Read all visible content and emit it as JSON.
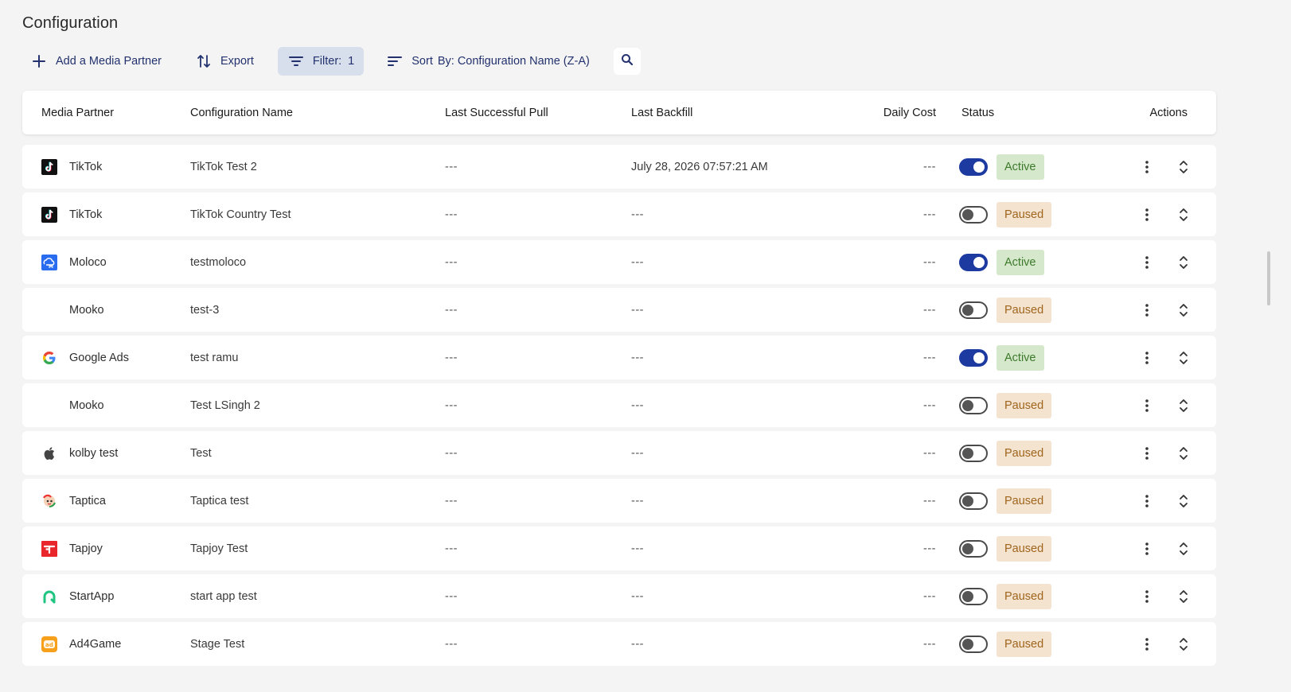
{
  "page": {
    "title": "Configuration"
  },
  "toolbar": {
    "add_label": "Add a Media Partner",
    "export_label": "Export",
    "filter_label": "Filter:",
    "filter_count": "1",
    "sort_prefix": "Sort",
    "sort_value": "By: Configuration Name (Z-A)"
  },
  "table": {
    "headers": {
      "partner": "Media Partner",
      "config": "Configuration Name",
      "pull": "Last Successful Pull",
      "backfill": "Last Backfill",
      "cost": "Daily Cost",
      "status": "Status",
      "actions": "Actions"
    },
    "rows": [
      {
        "partner": "TikTok",
        "logo": "tiktok-logo",
        "config": "TikTok Test 2",
        "pull": "---",
        "backfill": "July 28, 2026 07:57:21 AM",
        "cost": "---",
        "enabled": true,
        "status": "Active"
      },
      {
        "partner": "TikTok",
        "logo": "tiktok-logo",
        "config": "TikTok Country Test",
        "pull": "---",
        "backfill": "---",
        "cost": "---",
        "enabled": false,
        "status": "Paused"
      },
      {
        "partner": "Moloco",
        "logo": "moloco-logo",
        "config": "testmoloco",
        "pull": "---",
        "backfill": "---",
        "cost": "---",
        "enabled": true,
        "status": "Active"
      },
      {
        "partner": "Mooko",
        "logo": "none",
        "config": "test-3",
        "pull": "---",
        "backfill": "---",
        "cost": "---",
        "enabled": false,
        "status": "Paused"
      },
      {
        "partner": "Google Ads",
        "logo": "google-logo",
        "config": "test ramu",
        "pull": "---",
        "backfill": "---",
        "cost": "---",
        "enabled": true,
        "status": "Active"
      },
      {
        "partner": "Mooko",
        "logo": "none",
        "config": "Test LSingh 2",
        "pull": "---",
        "backfill": "---",
        "cost": "---",
        "enabled": false,
        "status": "Paused"
      },
      {
        "partner": "kolby test",
        "logo": "apple-logo",
        "config": "Test",
        "pull": "---",
        "backfill": "---",
        "cost": "---",
        "enabled": false,
        "status": "Paused"
      },
      {
        "partner": "Taptica",
        "logo": "taptica-logo",
        "config": "Taptica test",
        "pull": "---",
        "backfill": "---",
        "cost": "---",
        "enabled": false,
        "status": "Paused"
      },
      {
        "partner": "Tapjoy",
        "logo": "tapjoy-logo",
        "config": "Tapjoy Test",
        "pull": "---",
        "backfill": "---",
        "cost": "---",
        "enabled": false,
        "status": "Paused"
      },
      {
        "partner": "StartApp",
        "logo": "startapp-logo",
        "config": "start app test",
        "pull": "---",
        "backfill": "---",
        "cost": "---",
        "enabled": false,
        "status": "Paused"
      },
      {
        "partner": "Ad4Game",
        "logo": "ad4game-logo",
        "config": "Stage Test",
        "pull": "---",
        "backfill": "---",
        "cost": "---",
        "enabled": false,
        "status": "Paused"
      }
    ]
  },
  "colors": {
    "primary": "#1c3aa0",
    "link": "#23326e",
    "active_bg": "#d6e8cc",
    "active_text": "#3c7a2b",
    "paused_bg": "#f3e3cf",
    "paused_text": "#a0651d",
    "filter_bg": "#d7deec"
  }
}
